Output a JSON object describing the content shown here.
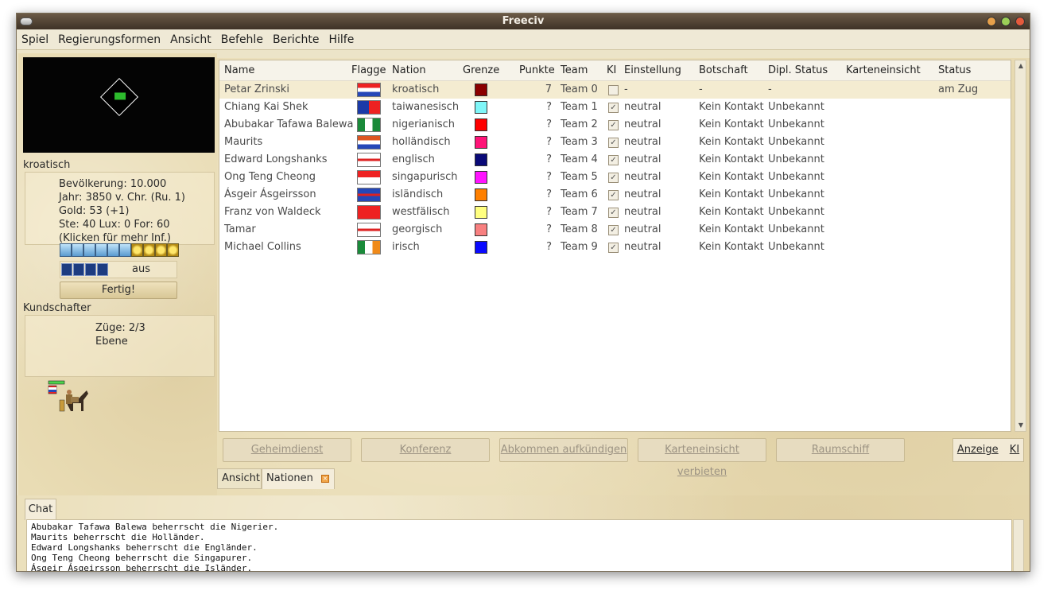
{
  "window": {
    "title": "Freeciv"
  },
  "menubar": {
    "items": [
      "Spiel",
      "Regierungsformen",
      "Ansicht",
      "Befehle",
      "Berichte",
      "Hilfe"
    ]
  },
  "player_info": {
    "nation": "kroatisch",
    "population": "Bevölkerung: 10.000",
    "year": "Jahr: 3850 v. Chr. (Ru. 1)",
    "gold": "Gold: 53 (+1)",
    "rates": "Ste: 40 Lux: 0 For: 60",
    "hint": "(Klicken für mehr Inf.)",
    "status": "aus",
    "done_button": "Fertig!"
  },
  "unit_info": {
    "name": "Kundschafter",
    "moves": "Züge: 2/3",
    "terrain": "Ebene"
  },
  "table": {
    "headers": [
      "Name",
      "Flagge",
      "Nation",
      "Grenze",
      "Punkte",
      "Team",
      "KI",
      "Einstellung",
      "Botschaft",
      "Dipl. Status",
      "Karteneinsicht",
      "Status"
    ],
    "rows": [
      {
        "name": "Petar Zrinski",
        "nation": "kroatisch",
        "color": "#8b0000",
        "points": "7",
        "team": "Team 0",
        "ai": false,
        "attitude": "-",
        "embassy": "-",
        "dipl": "-",
        "vision": "",
        "status": "am Zug"
      },
      {
        "name": "Chiang Kai Shek",
        "nation": "taiwanesisch",
        "color": "#7ff6f8",
        "points": "?",
        "team": "Team 1",
        "ai": true,
        "attitude": "neutral",
        "embassy": "Kein Kontakt",
        "dipl": "Unbekannt",
        "vision": "",
        "status": ""
      },
      {
        "name": "Abubakar Tafawa Balewa",
        "nation": "nigerianisch",
        "color": "#ff0000",
        "points": "?",
        "team": "Team 2",
        "ai": true,
        "attitude": "neutral",
        "embassy": "Kein Kontakt",
        "dipl": "Unbekannt",
        "vision": "",
        "status": ""
      },
      {
        "name": "Maurits",
        "nation": "holländisch",
        "color": "#ff1478",
        "points": "?",
        "team": "Team 3",
        "ai": true,
        "attitude": "neutral",
        "embassy": "Kein Kontakt",
        "dipl": "Unbekannt",
        "vision": "",
        "status": ""
      },
      {
        "name": "Edward Longshanks",
        "nation": "englisch",
        "color": "#0a0a78",
        "points": "?",
        "team": "Team 4",
        "ai": true,
        "attitude": "neutral",
        "embassy": "Kein Kontakt",
        "dipl": "Unbekannt",
        "vision": "",
        "status": ""
      },
      {
        "name": "Ong Teng Cheong",
        "nation": "singapurisch",
        "color": "#ff14ff",
        "points": "?",
        "team": "Team 5",
        "ai": true,
        "attitude": "neutral",
        "embassy": "Kein Kontakt",
        "dipl": "Unbekannt",
        "vision": "",
        "status": ""
      },
      {
        "name": "Ásgeir Ásgeirsson",
        "nation": "isländisch",
        "color": "#ff8000",
        "points": "?",
        "team": "Team 6",
        "ai": true,
        "attitude": "neutral",
        "embassy": "Kein Kontakt",
        "dipl": "Unbekannt",
        "vision": "",
        "status": ""
      },
      {
        "name": "Franz von Waldeck",
        "nation": "westfälisch",
        "color": "#ffff80",
        "points": "?",
        "team": "Team 7",
        "ai": true,
        "attitude": "neutral",
        "embassy": "Kein Kontakt",
        "dipl": "Unbekannt",
        "vision": "",
        "status": ""
      },
      {
        "name": "Tamar",
        "nation": "georgisch",
        "color": "#f88080",
        "points": "?",
        "team": "Team 8",
        "ai": true,
        "attitude": "neutral",
        "embassy": "Kein Kontakt",
        "dipl": "Unbekannt",
        "vision": "",
        "status": ""
      },
      {
        "name": "Michael Collins",
        "nation": "irisch",
        "color": "#0a0aff",
        "points": "?",
        "team": "Team 9",
        "ai": true,
        "attitude": "neutral",
        "embassy": "Kein Kontakt",
        "dipl": "Unbekannt",
        "vision": "",
        "status": ""
      }
    ]
  },
  "buttons": {
    "intel": "Geheimdienst",
    "meeting": "Konferenz",
    "cancel_treaty": "Abkommen aufkündigen",
    "withdraw_vision": "Karteneinsicht verbieten",
    "spaceship": "Raumschiff",
    "show": "Anzeige",
    "show_key": "KI"
  },
  "tabs": {
    "view": "Ansicht",
    "nations": "Nationen"
  },
  "chat": {
    "tab": "Chat",
    "lines": [
      "Abubakar Tafawa Balewa beherrscht die Nigerier.",
      "Maurits beherrscht die Holländer.",
      "Edward Longshanks beherrscht die Engländer.",
      "Ong Teng Cheong beherrscht die Singapurer.",
      "Ásgeir Ásgeirsson beherrscht die Isländer."
    ]
  }
}
